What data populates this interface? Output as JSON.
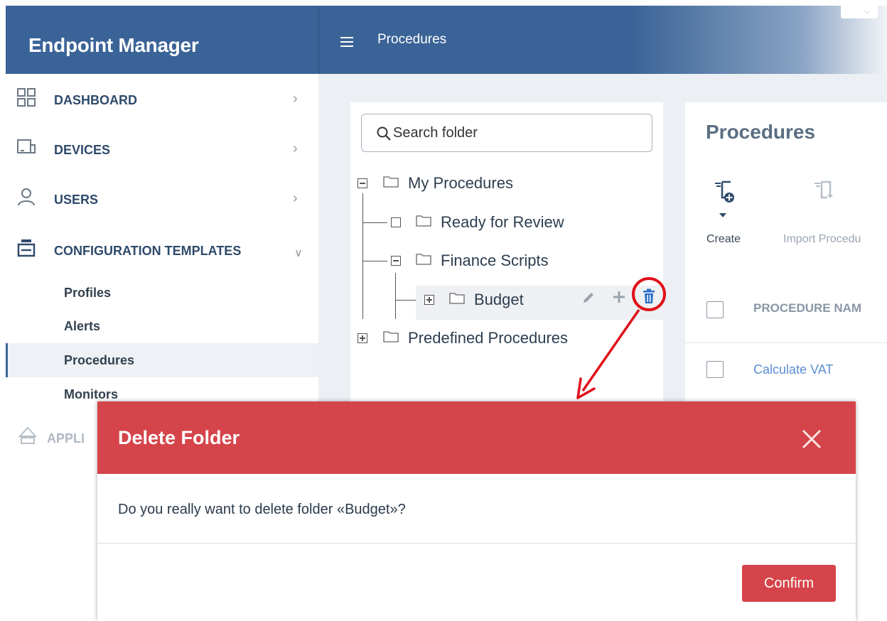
{
  "app": {
    "title": "Endpoint Manager"
  },
  "topbar": {
    "page_title": "Procedures",
    "dropdown_glyph": "⌵"
  },
  "sidebar": {
    "items": [
      {
        "label": "DASHBOARD",
        "icon": "grid-icon"
      },
      {
        "label": "DEVICES",
        "icon": "devices-icon"
      },
      {
        "label": "USERS",
        "icon": "user-icon"
      },
      {
        "label": "CONFIGURATION TEMPLATES",
        "icon": "templates-icon"
      },
      {
        "label": "APPLI",
        "icon": "applications-icon"
      }
    ],
    "subitems": [
      {
        "label": "Profiles"
      },
      {
        "label": "Alerts"
      },
      {
        "label": "Procedures",
        "active": true
      },
      {
        "label": "Monitors"
      }
    ]
  },
  "folder_tree": {
    "search_placeholder": "Search folder",
    "nodes": [
      {
        "label": "My Procedures"
      },
      {
        "label": "Ready for Review"
      },
      {
        "label": "Finance Scripts"
      },
      {
        "label": "Budget"
      },
      {
        "label": "Predefined Procedures"
      }
    ]
  },
  "procedures_panel": {
    "title": "Procedures",
    "toolbar": {
      "create_label": "Create",
      "import_label": "Import Procedu"
    },
    "table": {
      "column_header": "PROCEDURE NAM",
      "rows": [
        {
          "name": "Calculate VAT"
        }
      ]
    }
  },
  "modal": {
    "title": "Delete Folder",
    "message": "Do you really want to delete folder «Budget»?",
    "confirm_label": "Confirm"
  },
  "colors": {
    "header_blue": "#3a6397",
    "danger_red": "#d5444a",
    "link_blue": "#5b8ed0",
    "annotation_red": "#e0101a"
  }
}
